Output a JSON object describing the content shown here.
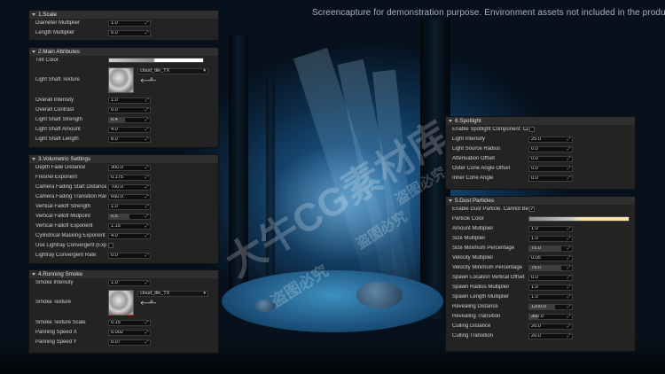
{
  "watermark": "Screencapture for demonstration purpose. Environment assets not included in the product.",
  "overlay_cn": [
    "大牛CG素材库",
    "盗图必究",
    "盗图必究",
    "盗图必究"
  ],
  "panels": {
    "scale": {
      "title": "1.Scale",
      "rows": [
        {
          "label": "Diameter Multiplier",
          "value": "1.0"
        },
        {
          "label": "Length Multiplier",
          "value": "5.0"
        }
      ]
    },
    "main": {
      "title": "2.Main Attributes",
      "tint_label": "Tint Color",
      "shaft_label": "Light Shaft Texture",
      "texture_name": "cloud_tile_TX",
      "back_icon": "arrow-left-icon",
      "browse_icon": "search-icon",
      "rows": [
        {
          "label": "Overall Intensity",
          "value": "1.0"
        },
        {
          "label": "Overall Contrast",
          "value": "0.0"
        },
        {
          "label": "Light Shaft Strength",
          "value": "0.4"
        },
        {
          "label": "Light Shaft Amount",
          "value": "4.0"
        },
        {
          "label": "Light Shaft Length",
          "value": "8.0"
        }
      ]
    },
    "volumetric": {
      "title": "3.Volumetric Settings",
      "rows": [
        {
          "label": "Depth Fade Distance",
          "value": "300.0"
        },
        {
          "label": "Fresnel Exponent",
          "value": "0.175"
        },
        {
          "label": "Camera Fading Start Distance",
          "value": "700.0"
        },
        {
          "label": "Camera Fading Transition Range",
          "value": "650.0"
        },
        {
          "label": "Vertical Falloff Strength",
          "value": "1.0"
        },
        {
          "label": "Vertical Falloff Midpoint",
          "value": "0.5"
        },
        {
          "label": "Vertical Falloff Exponent",
          "value": "1.15"
        },
        {
          "label": "Cylindrical Masking Exponent",
          "value": "4.0"
        }
      ],
      "checkbox_label": "Use Lightray Convergent (Experim",
      "checkbox_checked": false,
      "convergent_label": "Lightray Convergent Rate",
      "convergent_value": "0.0"
    },
    "smoke": {
      "title": "4.Running Smoke",
      "intensity_label": "Smoke Intensity",
      "intensity_value": "1.0",
      "texture_label": "Smoke Texture",
      "texture_name": "cloud_tile_TX",
      "rows": [
        {
          "label": "Smoke Texture Scale",
          "value": "0.15"
        },
        {
          "label": "Panning Speed X",
          "value": "0.002"
        },
        {
          "label": "Panning Speed Y",
          "value": "0.07"
        }
      ]
    },
    "spotlight": {
      "title": "6.Spotlight",
      "enable_label": "Enable Spotlight Component: Cas",
      "enable_checked": false,
      "rows": [
        {
          "label": "Light Intensity",
          "value": "25.0"
        },
        {
          "label": "Light Source Radius",
          "value": "0.0"
        },
        {
          "label": "Attenuation Offset",
          "value": "0.0"
        },
        {
          "label": "Outer Cone Angle Offset",
          "value": "0.0"
        },
        {
          "label": "Inner Cone Angle",
          "value": "0.0"
        }
      ]
    },
    "dust": {
      "title": "5.Dust Particles",
      "enable_label": "Enable Dust Particle. Cannot Be",
      "enable_checked": true,
      "color_label": "Particle Color",
      "rows": [
        {
          "label": "Amount Multiplier",
          "value": "1.0"
        },
        {
          "label": "Size Multiplier",
          "value": "1.0"
        },
        {
          "label": "Size Minimum Percentage",
          "value": "75.0"
        },
        {
          "label": "Velocity Multiplier",
          "value": "0.05"
        },
        {
          "label": "Velocity Minimum Percentage",
          "value": "75.0"
        },
        {
          "label": "Spawn Location Vertical Offset",
          "value": "0.0"
        },
        {
          "label": "Spawn Radius Multiplier",
          "value": "1.0"
        },
        {
          "label": "Spawn Length Multiplier",
          "value": "1.0"
        },
        {
          "label": "Revealing Distance",
          "value": "1200.0"
        },
        {
          "label": "Revealing Transition",
          "value": "300.0"
        },
        {
          "label": "Culling Distance",
          "value": "20.0"
        },
        {
          "label": "Culling Transition",
          "value": "20.0"
        }
      ]
    }
  },
  "slider_fill_fractions": {
    "light_shaft_strength": 0.4,
    "vertical_falloff_midpoint": 0.5,
    "size_minimum_percentage": 0.75,
    "velocity_minimum_percentage": 0.75,
    "revealing_distance": 0.6,
    "revealing_transition": 0.2
  },
  "colors": {
    "panel": "#232323",
    "header": "#2f2f2f",
    "dust_color_end": "#ffe2a8",
    "tint": "#ffffff"
  }
}
